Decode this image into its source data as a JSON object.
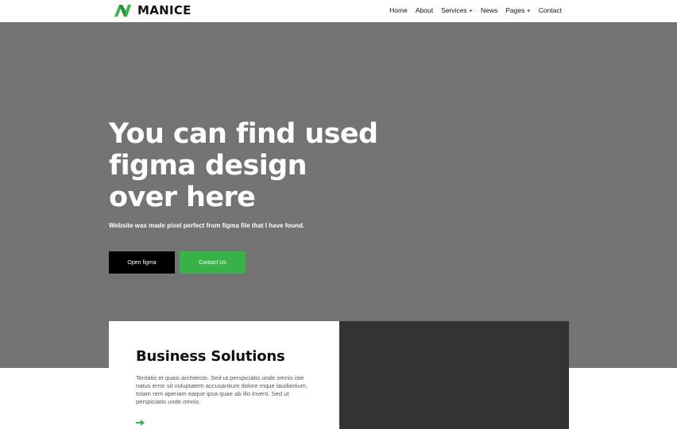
{
  "brand": {
    "name": "MANICE",
    "accent_color": "#37b34a"
  },
  "nav": {
    "items": [
      "Home",
      "About",
      "Services +",
      "News",
      "Pages +",
      "Contact"
    ]
  },
  "hero": {
    "title": "You can find used figma design over here",
    "subtitle": "Website was made pixel perfect from figma file that I have found.",
    "primary_button": "Open figma",
    "secondary_button": "Contact Us",
    "background_color": "#737373"
  },
  "card": {
    "title": "Business Solutions",
    "text": "Teritatis et quasi architecto. Sed ut perspiciatis unde omnis iste natus error sit voluptatem accusantium dolore mque laudantium, totam rem aperiam eaque ipsa quae ab illo invent. Sed ut perspiciatis unde omnis.",
    "arrow_icon": "arrow-right-icon",
    "dark_panel_color": "#333333"
  }
}
